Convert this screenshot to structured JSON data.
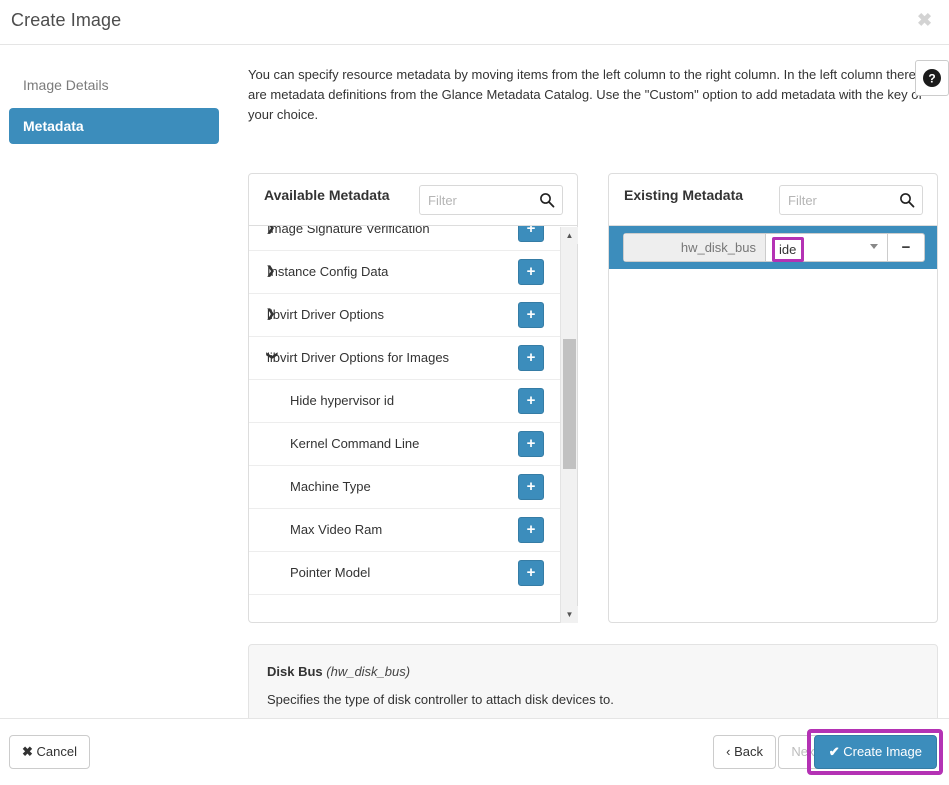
{
  "modal": {
    "title": "Create Image",
    "close_icon": "close-icon"
  },
  "sidebar": {
    "items": [
      {
        "label": "Image Details",
        "active": false
      },
      {
        "label": "Metadata",
        "active": true
      }
    ]
  },
  "content": {
    "intro": "You can specify resource metadata by moving items from the left column to the right column. In the left column there are metadata definitions from the Glance Metadata Catalog. Use the \"Custom\" option to add metadata with the key of your choice.",
    "help_icon": "question-circle-icon"
  },
  "available_panel": {
    "title": "Available Metadata",
    "filter": {
      "value": "",
      "placeholder": "Filter",
      "icon": "search-icon"
    },
    "rows": [
      {
        "label": "Image Signature Verification",
        "expandable": true,
        "expanded": false,
        "child": false,
        "add_label": "+"
      },
      {
        "label": "Instance Config Data",
        "expandable": true,
        "expanded": false,
        "child": false,
        "add_label": "+"
      },
      {
        "label": "libvirt Driver Options",
        "expandable": true,
        "expanded": false,
        "child": false,
        "add_label": "+"
      },
      {
        "label": "libvirt Driver Options for Images",
        "expandable": true,
        "expanded": true,
        "child": false,
        "add_label": "+"
      },
      {
        "label": "Hide hypervisor id",
        "expandable": false,
        "expanded": false,
        "child": true,
        "add_label": "+"
      },
      {
        "label": "Kernel Command Line",
        "expandable": false,
        "expanded": false,
        "child": true,
        "add_label": "+"
      },
      {
        "label": "Machine Type",
        "expandable": false,
        "expanded": false,
        "child": true,
        "add_label": "+"
      },
      {
        "label": "Max Video Ram",
        "expandable": false,
        "expanded": false,
        "child": true,
        "add_label": "+"
      },
      {
        "label": "Pointer Model",
        "expandable": false,
        "expanded": false,
        "child": true,
        "add_label": "+"
      }
    ],
    "scrollbar": {
      "up_arrow": "▲",
      "down_arrow": "▼"
    }
  },
  "existing_panel": {
    "title": "Existing Metadata",
    "filter": {
      "value": "",
      "placeholder": "Filter",
      "icon": "search-icon"
    },
    "rows": [
      {
        "key": "hw_disk_bus",
        "value": "ide",
        "remove_label": "−",
        "selected": true,
        "value_highlighted": true
      }
    ]
  },
  "description": {
    "name": "Disk Bus",
    "key": "(hw_disk_bus)",
    "text": "Specifies the type of disk controller to attach disk devices to."
  },
  "footer": {
    "cancel_label": "Cancel",
    "back_label": "‹ Back",
    "next_label": "Next ›",
    "create_label": "Create Image",
    "cancel_icon": "✖",
    "create_icon": "✔"
  },
  "colors": {
    "accent": "#3c8dbc",
    "highlight": "#b432b4",
    "panel_border": "#dddddd",
    "desc_bg": "#f7f7f7"
  }
}
